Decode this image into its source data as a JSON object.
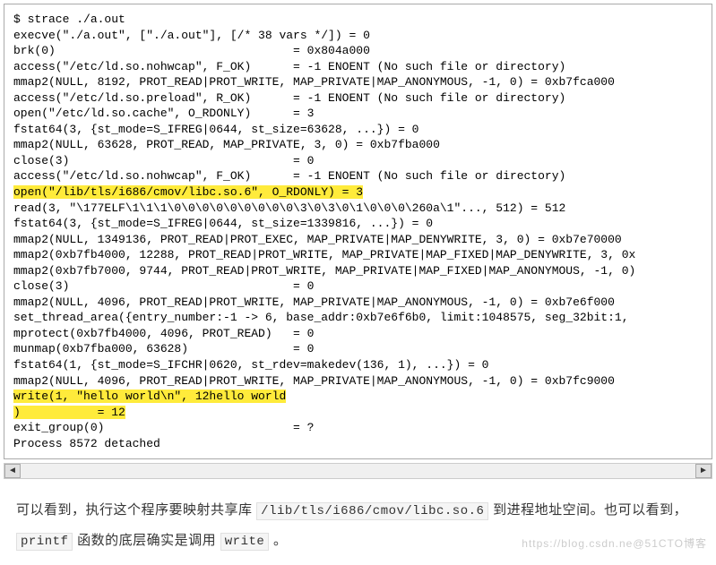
{
  "terminal": {
    "lines": [
      {
        "text": "$ strace ./a.out",
        "hl": false
      },
      {
        "text": "execve(\"./a.out\", [\"./a.out\"], [/* 38 vars */]) = 0",
        "hl": false
      },
      {
        "text": "brk(0)                                  = 0x804a000",
        "hl": false
      },
      {
        "text": "access(\"/etc/ld.so.nohwcap\", F_OK)      = -1 ENOENT (No such file or directory)",
        "hl": false
      },
      {
        "text": "mmap2(NULL, 8192, PROT_READ|PROT_WRITE, MAP_PRIVATE|MAP_ANONYMOUS, -1, 0) = 0xb7fca000",
        "hl": false
      },
      {
        "text": "access(\"/etc/ld.so.preload\", R_OK)      = -1 ENOENT (No such file or directory)",
        "hl": false
      },
      {
        "text": "open(\"/etc/ld.so.cache\", O_RDONLY)      = 3",
        "hl": false
      },
      {
        "text": "fstat64(3, {st_mode=S_IFREG|0644, st_size=63628, ...}) = 0",
        "hl": false
      },
      {
        "text": "mmap2(NULL, 63628, PROT_READ, MAP_PRIVATE, 3, 0) = 0xb7fba000",
        "hl": false
      },
      {
        "text": "close(3)                                = 0",
        "hl": false
      },
      {
        "text": "access(\"/etc/ld.so.nohwcap\", F_OK)      = -1 ENOENT (No such file or directory)",
        "hl": false
      },
      {
        "text": "open(\"/lib/tls/i686/cmov/libc.so.6\", O_RDONLY) = 3",
        "hl": true
      },
      {
        "text": "read(3, \"\\177ELF\\1\\1\\1\\0\\0\\0\\0\\0\\0\\0\\0\\0\\3\\0\\3\\0\\1\\0\\0\\0\\260a\\1\"..., 512) = 512",
        "hl": false
      },
      {
        "text": "fstat64(3, {st_mode=S_IFREG|0644, st_size=1339816, ...}) = 0",
        "hl": false
      },
      {
        "text": "mmap2(NULL, 1349136, PROT_READ|PROT_EXEC, MAP_PRIVATE|MAP_DENYWRITE, 3, 0) = 0xb7e70000",
        "hl": false
      },
      {
        "text": "mmap2(0xb7fb4000, 12288, PROT_READ|PROT_WRITE, MAP_PRIVATE|MAP_FIXED|MAP_DENYWRITE, 3, 0x",
        "hl": false
      },
      {
        "text": "mmap2(0xb7fb7000, 9744, PROT_READ|PROT_WRITE, MAP_PRIVATE|MAP_FIXED|MAP_ANONYMOUS, -1, 0)",
        "hl": false
      },
      {
        "text": "close(3)                                = 0",
        "hl": false
      },
      {
        "text": "mmap2(NULL, 4096, PROT_READ|PROT_WRITE, MAP_PRIVATE|MAP_ANONYMOUS, -1, 0) = 0xb7e6f000",
        "hl": false
      },
      {
        "text": "set_thread_area({entry_number:-1 -> 6, base_addr:0xb7e6f6b0, limit:1048575, seg_32bit:1,",
        "hl": false
      },
      {
        "text": "mprotect(0xb7fb4000, 4096, PROT_READ)   = 0",
        "hl": false
      },
      {
        "text": "munmap(0xb7fba000, 63628)               = 0",
        "hl": false
      },
      {
        "text": "fstat64(1, {st_mode=S_IFCHR|0620, st_rdev=makedev(136, 1), ...}) = 0",
        "hl": false
      },
      {
        "text": "mmap2(NULL, 4096, PROT_READ|PROT_WRITE, MAP_PRIVATE|MAP_ANONYMOUS, -1, 0) = 0xb7fc9000",
        "hl": false
      },
      {
        "text": "write(1, \"hello world\\n\", 12hello world",
        "hl": true
      },
      {
        "text": ")           = 12",
        "hl": true
      },
      {
        "text": "exit_group(0)                           = ?",
        "hl": false
      },
      {
        "text": "Process 8572 detached",
        "hl": false
      }
    ]
  },
  "scrollbar": {
    "left_glyph": "◄",
    "right_glyph": "►"
  },
  "explanation": {
    "part1": "可以看到，执行这个程序要映射共享库 ",
    "code1": "/lib/tls/i686/cmov/libc.so.6",
    "part2": " 到进程地址空间。也可以看到， ",
    "code2": "printf",
    "part3": " 函数的底层确实是调用 ",
    "code3": "write",
    "part4": " 。"
  },
  "watermark": "https://blog.csdn.ne@51CTO博客"
}
